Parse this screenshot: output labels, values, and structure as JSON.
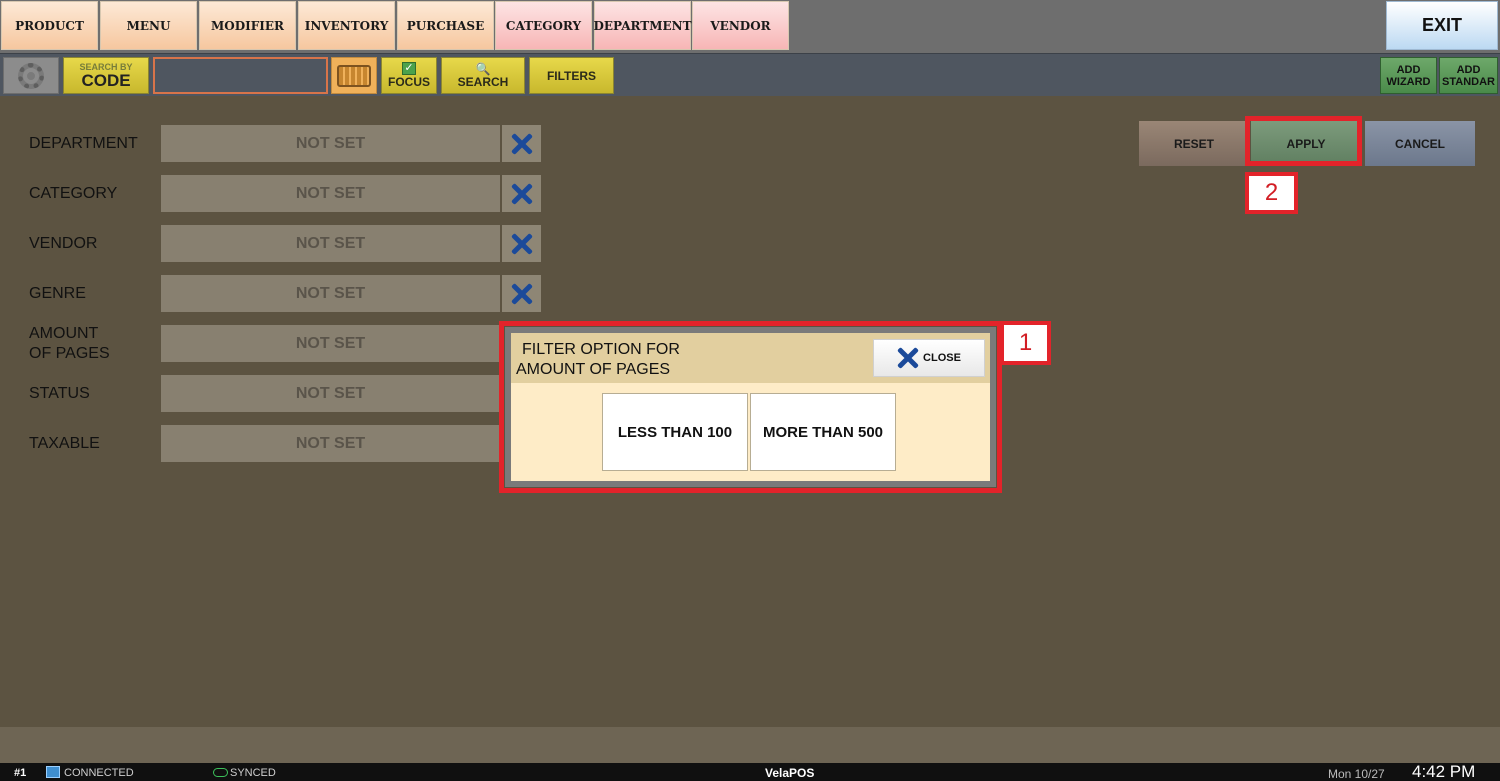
{
  "nav": {
    "items": [
      {
        "label": "PRODUCT",
        "color": "orange"
      },
      {
        "label": "MENU",
        "color": "orange"
      },
      {
        "label": "MODIFIER",
        "color": "orange"
      },
      {
        "label": "INVENTORY",
        "color": "orange"
      },
      {
        "label": "PURCHASE",
        "color": "orange"
      },
      {
        "label": "CATEGORY",
        "color": "pink"
      },
      {
        "label": "DEPARTMENT",
        "color": "pink"
      },
      {
        "label": "VENDOR",
        "color": "pink"
      }
    ],
    "exit_label": "EXIT"
  },
  "toolbar": {
    "search_by_small": "SEARCH BY",
    "search_by_big": "CODE",
    "search_value": "",
    "focus_label": "FOCUS",
    "focus_checked": "✓",
    "search_label": "SEARCH",
    "search_icon": "🔍",
    "filters_label": "FILTERS",
    "add_wizard_label_1": "ADD",
    "add_wizard_label_2": "WIZARD",
    "add_standard_label_1": "ADD",
    "add_standard_label_2": "STANDAR"
  },
  "filters": [
    {
      "label": "DEPARTMENT",
      "value": "NOT SET"
    },
    {
      "label": "CATEGORY",
      "value": "NOT SET"
    },
    {
      "label": "VENDOR",
      "value": "NOT SET"
    },
    {
      "label": "GENRE",
      "value": "NOT SET"
    },
    {
      "label_line1": "AMOUNT",
      "label_line2": "OF PAGES",
      "value": "NOT SET"
    },
    {
      "label": "STATUS",
      "value": "NOT SET"
    },
    {
      "label": "TAXABLE",
      "value": "NOT SET"
    }
  ],
  "actions": {
    "reset_label": "RESET",
    "apply_label": "APPLY",
    "cancel_label": "CANCEL"
  },
  "modal": {
    "title_line1": "FILTER OPTION FOR",
    "title_line2": "AMOUNT OF PAGES",
    "close_label": "CLOSE",
    "options": [
      "LESS THAN 100",
      "MORE THAN 500"
    ]
  },
  "annotations": {
    "box1_number": "1",
    "box2_number": "2",
    "color": "#e3232a"
  },
  "statusbar": {
    "terminal": "#1",
    "connection": "CONNECTED",
    "sync": "SYNCED",
    "brand_a": "Vela",
    "brand_b": "POS",
    "date": "Mon 10/27",
    "time": "4:42 PM"
  }
}
